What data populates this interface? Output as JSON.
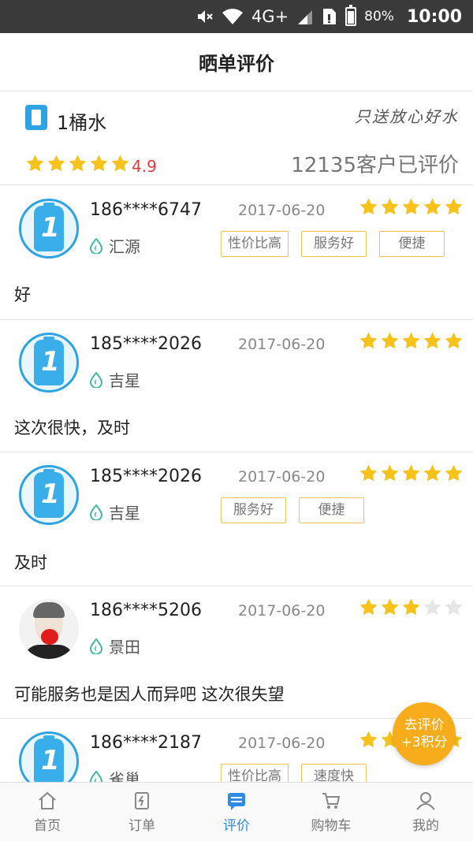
{
  "status_bar": {
    "network": "4G+",
    "battery": "80%",
    "battery_level": 0.8,
    "time": "10:00"
  },
  "header": {
    "title": "晒单评价"
  },
  "summary": {
    "brand_name": "1桶水",
    "slogan": "只送放心好水",
    "rating_stars": 5,
    "rating": "4.9",
    "review_count": "12135客户已评价"
  },
  "reviews": [
    {
      "avatar": "bottle-avatar",
      "phone": "186****6747",
      "date": "2017-06-20",
      "stars": 5,
      "station": "汇源",
      "tags": [
        "性价比高",
        "服务好",
        "便捷"
      ],
      "comment": "好"
    },
    {
      "avatar": "bottle-avatar",
      "phone": "185****2026",
      "date": "2017-06-20",
      "stars": 5,
      "station": "吉星",
      "tags": [],
      "comment": "这次很快，及时"
    },
    {
      "avatar": "bottle-avatar",
      "phone": "185****2026",
      "date": "2017-06-20",
      "stars": 5,
      "station": "吉星",
      "tags": [
        "服务好",
        "便捷"
      ],
      "comment": "及时"
    },
    {
      "avatar": "person-avatar",
      "phone": "186****5206",
      "date": "2017-06-20",
      "stars": 3,
      "station": "景田",
      "tags": [],
      "comment": "可能服务也是因人而异吧 这次很失望"
    },
    {
      "avatar": "bottle-avatar",
      "phone": "186****2187",
      "date": "2017-06-20",
      "stars": 5,
      "station": "雀巢",
      "tags": [
        "性价比高",
        "速度快"
      ],
      "comment": ""
    }
  ],
  "fab": {
    "line1": "去评价",
    "line2": "+3积分"
  },
  "nav": [
    {
      "label": "首页",
      "icon": "home-icon",
      "active": false
    },
    {
      "label": "订单",
      "icon": "order-icon",
      "active": false
    },
    {
      "label": "评价",
      "icon": "review-icon",
      "active": true
    },
    {
      "label": "购物车",
      "icon": "cart-icon",
      "active": false
    },
    {
      "label": "我的",
      "icon": "profile-icon",
      "active": false
    }
  ],
  "colors": {
    "accent": "#2e8be4",
    "star": "#f8c21c",
    "star_empty": "#e6e6e6",
    "rating": "#e4393c",
    "tag_border": "#f0c15a",
    "fab": "#f6ac1b"
  }
}
